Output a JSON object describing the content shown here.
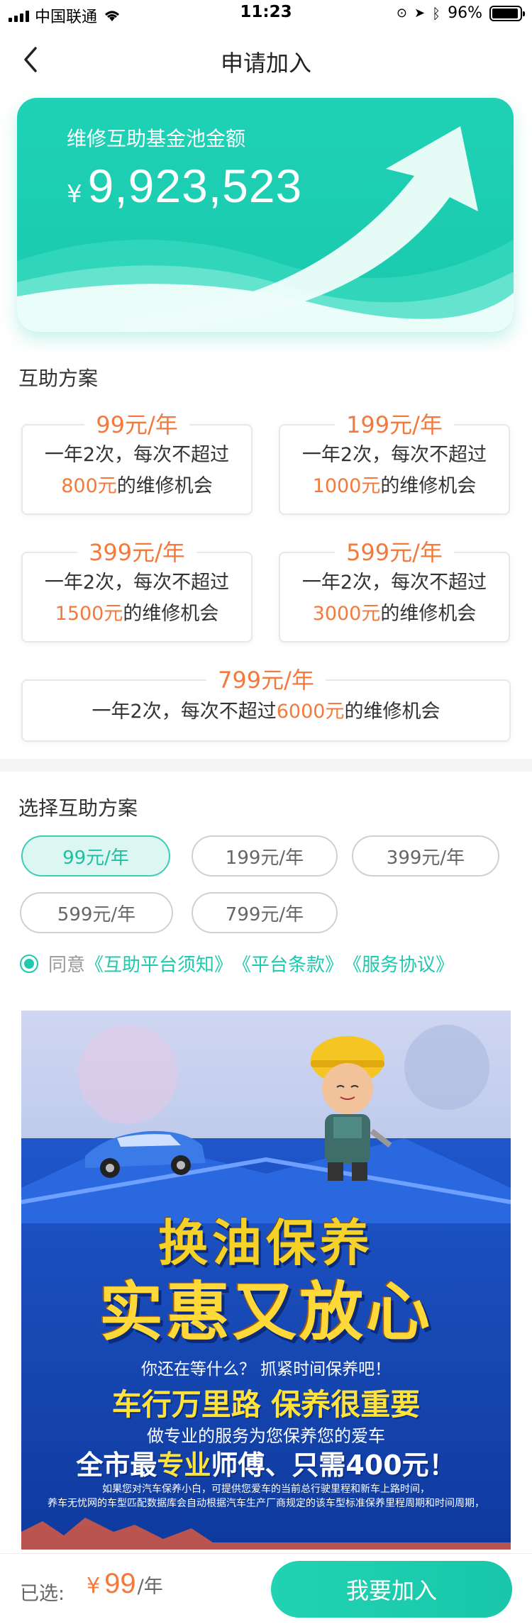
{
  "status_bar": {
    "carrier": "中国联通",
    "time": "11:23",
    "battery": "96%"
  },
  "nav": {
    "title": "申请加入"
  },
  "fund": {
    "label": "维修互助基金池金额",
    "currency": "¥",
    "amount": "9,923,523"
  },
  "plans_section": {
    "title": "互助方案",
    "plans": [
      {
        "price": "99元/年",
        "line1": "一年2次，每次不超过",
        "amount": "800元",
        "suffix": "的维修机会"
      },
      {
        "price": "199元/年",
        "line1": "一年2次，每次不超过",
        "amount": "1000元",
        "suffix": "的维修机会"
      },
      {
        "price": "399元/年",
        "line1": "一年2次，每次不超过",
        "amount": "1500元",
        "suffix": "的维修机会"
      },
      {
        "price": "599元/年",
        "line1": "一年2次，每次不超过",
        "amount": "3000元",
        "suffix": "的维修机会"
      },
      {
        "price": "799元/年",
        "line1": "一年2次，每次不超过",
        "amount": "6000元",
        "suffix": "的维修机会"
      }
    ]
  },
  "select_section": {
    "title": "选择互助方案",
    "options": [
      "99元/年",
      "199元/年",
      "399元/年",
      "599元/年",
      "799元/年"
    ],
    "selected_index": 0,
    "agree_prefix": "同意",
    "links": [
      "《互助平台须知》",
      "《平台条款》",
      "《服务协议》"
    ]
  },
  "poster": {
    "headline1": "换油保养",
    "headline2": "实惠又放心",
    "line1": "你还在等什么？ 抓紧时间保养吧！",
    "line2": "车行万里路  保养很重要",
    "line3": "做专业的服务为您保养您的爱车",
    "line4_a": "全市最",
    "line4_b": "专业",
    "line4_c": "师傅、只需400元！",
    "line5": "如果您对汽车保养小白，可提供您爱车的当前总行驶里程和新车上路时间，",
    "line6": "养车无忧网的车型匹配数据库会自动根据汽车生产厂商规定的该车型标准保养里程周期和时间周期，"
  },
  "bottom": {
    "selected_label": "已选:",
    "currency": "¥",
    "price": "99",
    "unit": "/年",
    "join_label": "我要加入"
  },
  "colors": {
    "accent": "#1fc9ad",
    "price": "#f37a3c"
  }
}
